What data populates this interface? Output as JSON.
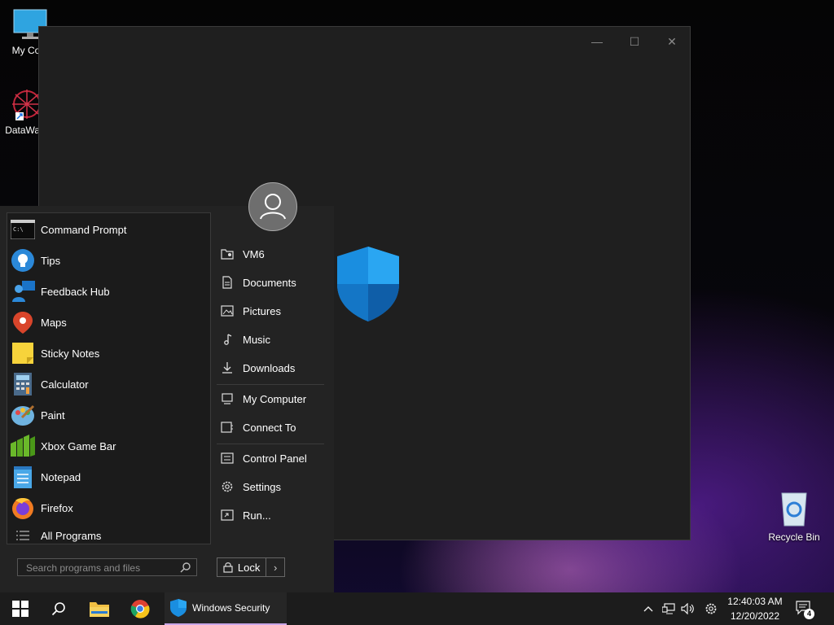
{
  "desktop": {
    "icons": [
      {
        "label": "My Com",
        "icon": "monitor-icon"
      },
      {
        "label": "DataWag",
        "icon": "datawag-icon"
      },
      {
        "label": "Recycle Bin",
        "icon": "recycle-bin-icon"
      }
    ]
  },
  "window": {
    "minimize": "—",
    "maximize": "☐",
    "close": "✕",
    "icon": "windows-security-shield-icon"
  },
  "start_menu": {
    "apps": [
      {
        "label": "Command Prompt",
        "icon": "command-prompt-icon"
      },
      {
        "label": "Tips",
        "icon": "tips-icon"
      },
      {
        "label": "Feedback Hub",
        "icon": "feedback-hub-icon"
      },
      {
        "label": "Maps",
        "icon": "maps-icon"
      },
      {
        "label": "Sticky Notes",
        "icon": "sticky-notes-icon"
      },
      {
        "label": "Calculator",
        "icon": "calculator-icon"
      },
      {
        "label": "Paint",
        "icon": "paint-icon"
      },
      {
        "label": "Xbox Game Bar",
        "icon": "xbox-game-bar-icon"
      },
      {
        "label": "Notepad",
        "icon": "notepad-icon"
      },
      {
        "label": "Firefox",
        "icon": "firefox-icon"
      }
    ],
    "all_programs": "All Programs",
    "search_placeholder": "Search programs and files",
    "places": [
      {
        "label": "VM6",
        "icon": "user-folder-icon"
      },
      {
        "label": "Documents",
        "icon": "document-icon"
      },
      {
        "label": "Pictures",
        "icon": "picture-icon"
      },
      {
        "label": "Music",
        "icon": "music-icon"
      },
      {
        "label": "Downloads",
        "icon": "download-icon"
      },
      {
        "label": "My Computer",
        "icon": "computer-icon"
      },
      {
        "label": "Connect To",
        "icon": "connect-icon"
      },
      {
        "label": "Control Panel",
        "icon": "control-panel-icon"
      },
      {
        "label": "Settings",
        "icon": "gear-icon"
      },
      {
        "label": "Run...",
        "icon": "run-icon"
      }
    ],
    "lock_label": "Lock",
    "lock_arrow": "›"
  },
  "taskbar": {
    "active_app": "Windows Security",
    "time": "12:40:03 AM",
    "date": "12/20/2022",
    "notification_count": "4"
  }
}
